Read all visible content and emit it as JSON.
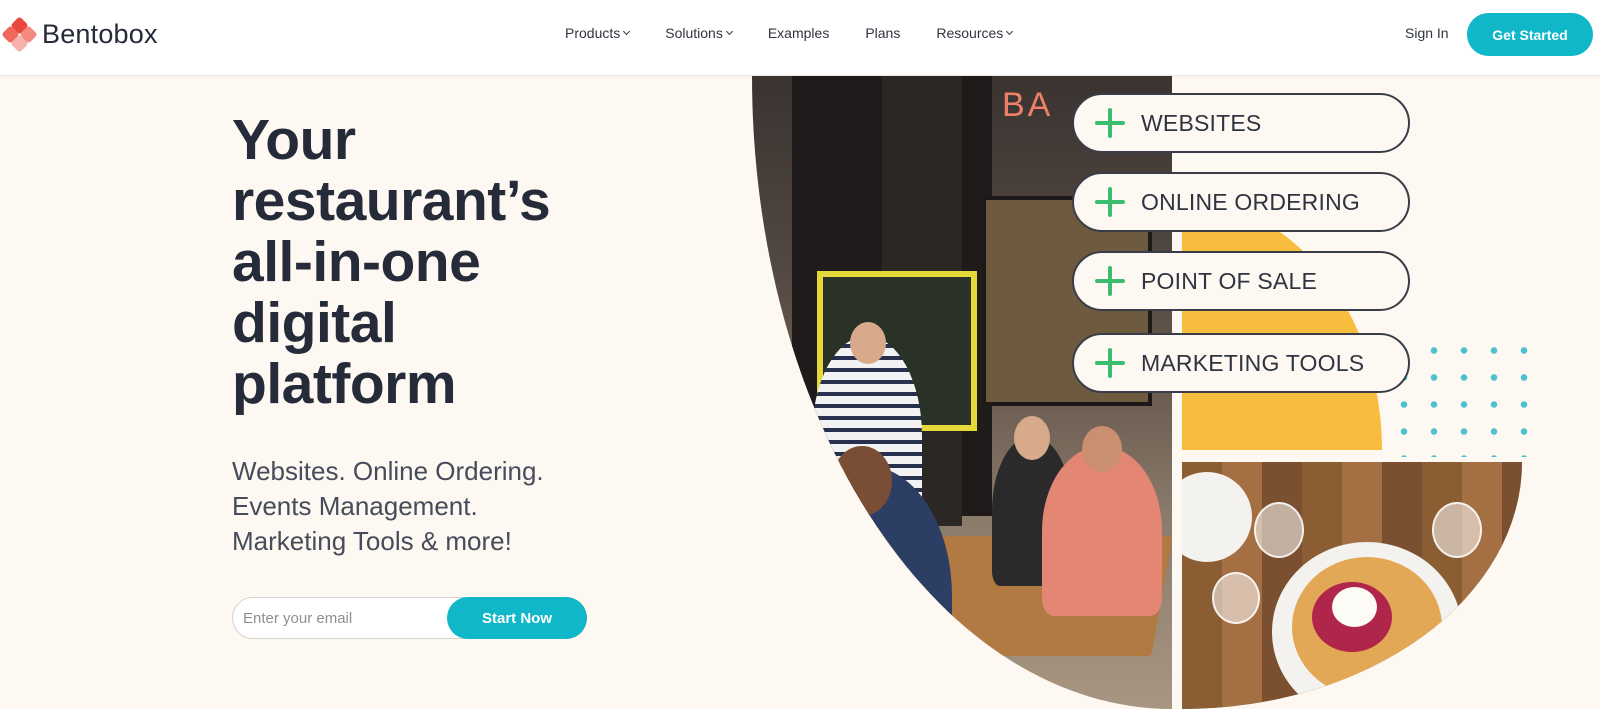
{
  "header": {
    "logo_text": "Bentobox",
    "nav": [
      {
        "label": "Products",
        "has_dropdown": true
      },
      {
        "label": "Solutions",
        "has_dropdown": true
      },
      {
        "label": "Examples",
        "has_dropdown": false
      },
      {
        "label": "Plans",
        "has_dropdown": false
      },
      {
        "label": "Resources",
        "has_dropdown": true
      }
    ],
    "sign_in_label": "Sign In",
    "cta_label": "Get Started"
  },
  "hero": {
    "headline_lines": [
      "Your",
      "restaurant’s",
      "all-in-one",
      "digital",
      "platform"
    ],
    "subhead_lines": [
      "Websites. Online Ordering.",
      "Events Management.",
      "Marketing Tools & more!"
    ],
    "email_placeholder": "Enter your email",
    "submit_label": "Start Now"
  },
  "visual": {
    "storefront_sign": "BA",
    "features": [
      "WEBSITES",
      "ONLINE ORDERING",
      "POINT OF SALE",
      "MARKETING TOOLS"
    ]
  },
  "colors": {
    "accent": "#0fb7c8",
    "plus_green": "#3cbc6e",
    "circle_yellow": "#f8bd3e",
    "background": "#fdf8f1",
    "text": "#262b3a"
  },
  "icons": {
    "dropdown": "chevron-down-icon",
    "feature": "plus-icon"
  }
}
